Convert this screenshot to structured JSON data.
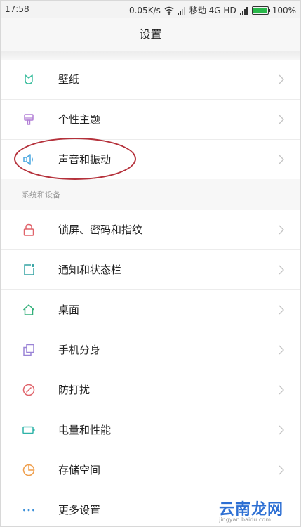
{
  "status_bar": {
    "time": "17:58",
    "net_speed": "0.05K/s",
    "carrier": "移动 4G HD",
    "battery_percent": "100%"
  },
  "header": {
    "title": "设置"
  },
  "section1": {
    "items": [
      {
        "label": "壁纸",
        "icon": "wallpaper-icon",
        "color": "#3fbfa0"
      },
      {
        "label": "个性主题",
        "icon": "theme-brush-icon",
        "color": "#b27fd6"
      },
      {
        "label": "声音和振动",
        "icon": "speaker-icon",
        "color": "#4aa7e0"
      }
    ]
  },
  "section2": {
    "header": "系统和设备",
    "items": [
      {
        "label": "锁屏、密码和指纹",
        "icon": "lock-icon",
        "color": "#e0636a"
      },
      {
        "label": "通知和状态栏",
        "icon": "notification-icon",
        "color": "#34a3a3"
      },
      {
        "label": "桌面",
        "icon": "home-icon",
        "color": "#33b07a"
      },
      {
        "label": "手机分身",
        "icon": "dual-space-icon",
        "color": "#9a83d6"
      },
      {
        "label": "防打扰",
        "icon": "do-not-disturb-icon",
        "color": "#e0636a"
      },
      {
        "label": "电量和性能",
        "icon": "battery-icon",
        "color": "#2fb3a8"
      },
      {
        "label": "存储空间",
        "icon": "storage-pie-icon",
        "color": "#ef9e4b"
      },
      {
        "label": "更多设置",
        "icon": "more-dots-icon",
        "color": "#3a8fd8"
      }
    ]
  },
  "watermark": {
    "text": "云南龙网",
    "sub": "jingyan.baidu.com"
  }
}
